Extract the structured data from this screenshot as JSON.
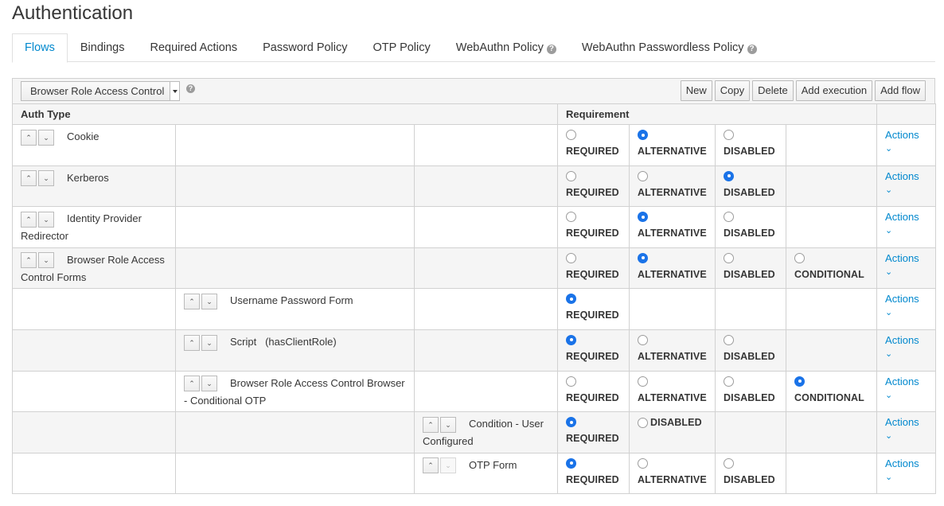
{
  "page": {
    "title": "Authentication"
  },
  "tabs": [
    {
      "label": "Flows",
      "active": true
    },
    {
      "label": "Bindings"
    },
    {
      "label": "Required Actions"
    },
    {
      "label": "Password Policy"
    },
    {
      "label": "OTP Policy"
    },
    {
      "label": "WebAuthn Policy",
      "help": true
    },
    {
      "label": "WebAuthn Passwordless Policy",
      "help": true
    }
  ],
  "toolbar": {
    "selected_flow": "Browser Role Access Control",
    "buttons": {
      "new": "New",
      "copy": "Copy",
      "delete": "Delete",
      "add_execution": "Add execution",
      "add_flow": "Add flow"
    }
  },
  "table": {
    "headers": {
      "auth_type": "Auth Type",
      "requirement": "Requirement"
    },
    "actions_label": "Actions",
    "rows": [
      {
        "name": "Cookie",
        "level": 0,
        "options": [
          "REQUIRED",
          "ALTERNATIVE",
          "DISABLED"
        ],
        "selected": "ALTERNATIVE"
      },
      {
        "name": "Kerberos",
        "level": 0,
        "options": [
          "REQUIRED",
          "ALTERNATIVE",
          "DISABLED"
        ],
        "selected": "DISABLED"
      },
      {
        "name": "Identity Provider Redirector",
        "level": 0,
        "options": [
          "REQUIRED",
          "ALTERNATIVE",
          "DISABLED"
        ],
        "selected": "ALTERNATIVE"
      },
      {
        "name": "Browser Role Access Control Forms",
        "level": 0,
        "options": [
          "REQUIRED",
          "ALTERNATIVE",
          "DISABLED",
          "CONDITIONAL"
        ],
        "selected": "ALTERNATIVE"
      },
      {
        "name": "Username Password Form",
        "level": 1,
        "options": [
          "REQUIRED"
        ],
        "selected": "REQUIRED"
      },
      {
        "name": "Script   (hasClientRole)",
        "level": 1,
        "options": [
          "REQUIRED",
          "ALTERNATIVE",
          "DISABLED"
        ],
        "selected": "REQUIRED"
      },
      {
        "name": "Browser Role Access Control Browser - Conditional OTP",
        "level": 1,
        "options": [
          "REQUIRED",
          "ALTERNATIVE",
          "DISABLED",
          "CONDITIONAL"
        ],
        "selected": "CONDITIONAL"
      },
      {
        "name": "Condition - User Configured",
        "level": 2,
        "options": [
          "REQUIRED",
          "DISABLED"
        ],
        "selected": "REQUIRED",
        "inline_second": true
      },
      {
        "name": "OTP Form",
        "level": 2,
        "options": [
          "REQUIRED",
          "ALTERNATIVE",
          "DISABLED"
        ],
        "selected": "REQUIRED",
        "down_disabled": true
      }
    ]
  },
  "colors": {
    "accent": "#0088ce",
    "radio_selected": "#1a73e8",
    "row_alt": "#f5f5f5",
    "border": "#d1d1d1"
  },
  "icons": {
    "up": "chevron-up-icon",
    "down": "chevron-down-icon",
    "help": "help-circle-icon"
  }
}
